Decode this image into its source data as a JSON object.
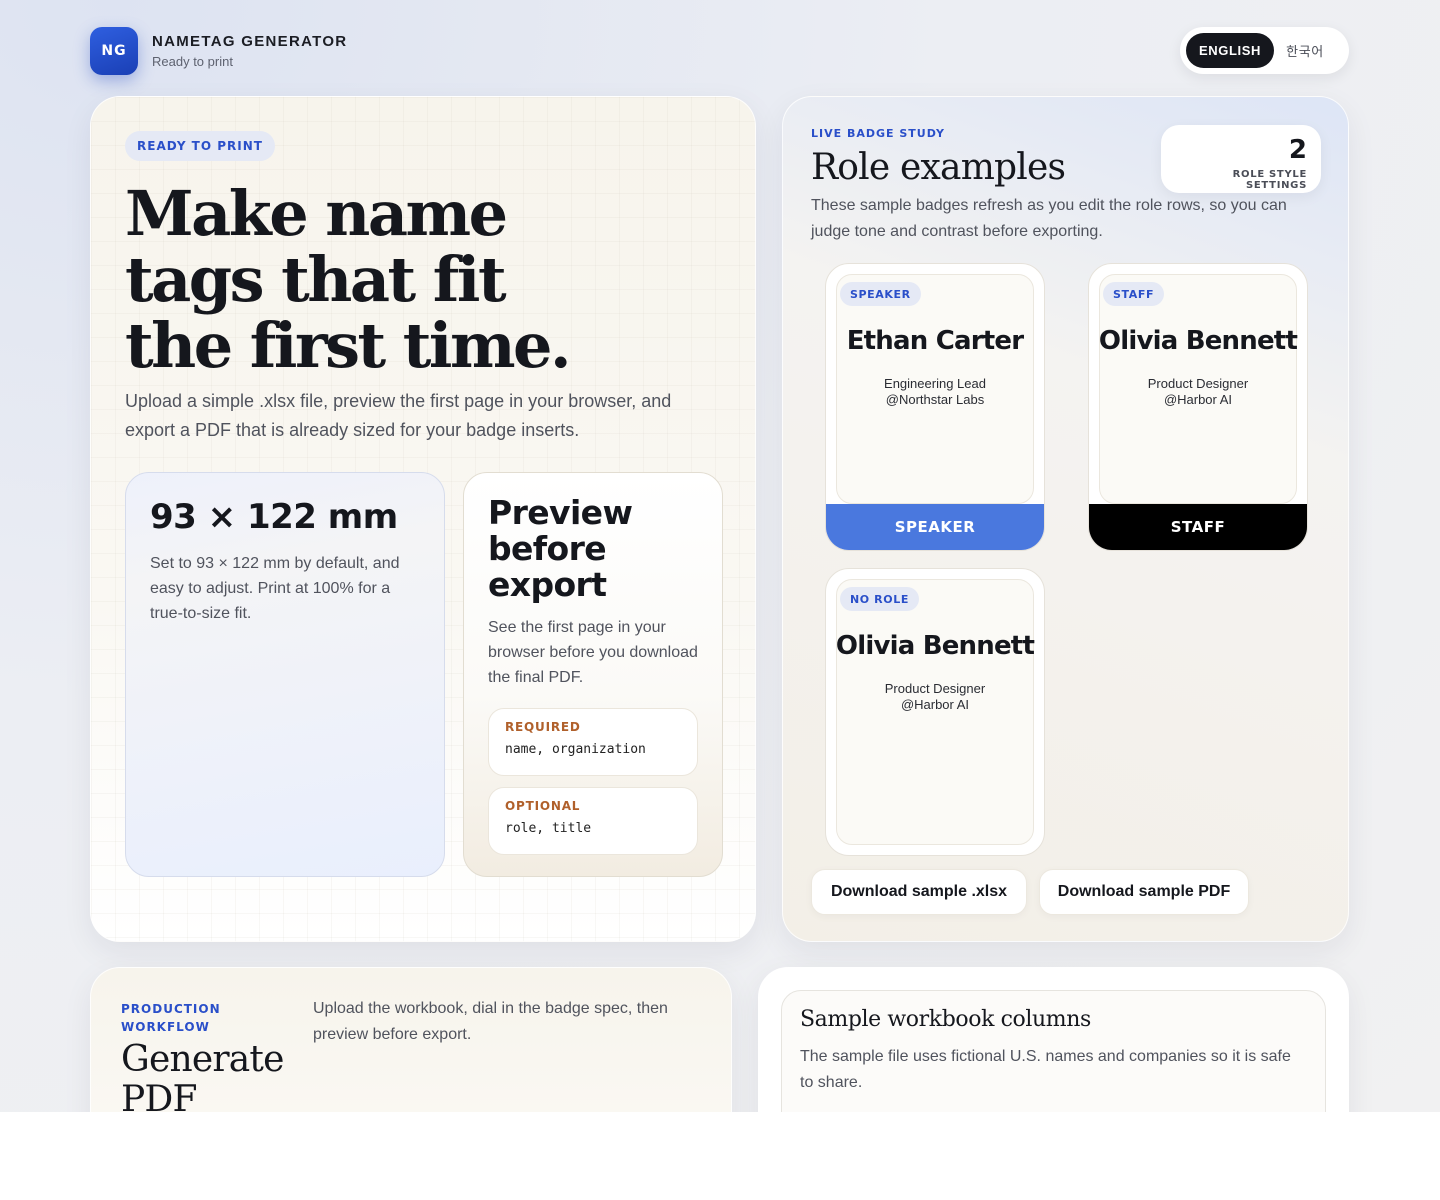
{
  "brand": {
    "logo": "NG",
    "title": "NAMETAG GENERATOR",
    "status": "Ready to print"
  },
  "language": {
    "active": "ENGLISH",
    "inactive": "한국어"
  },
  "hero": {
    "pill": "READY TO PRINT",
    "title_lines": [
      "Make name",
      "tags that fit",
      "the first time."
    ],
    "body": "Upload a simple .xlsx file, preview the first page in your browser, and export a PDF that is already sized for your badge inserts.",
    "size_card": {
      "title": "93 × 122 mm",
      "body": "Set to 93 × 122 mm by default, and easy to adjust. Print at 100% for a true-to-size fit."
    },
    "preview_card": {
      "title": "Preview before export",
      "body": "See the first page in your browser before you download the final PDF.",
      "required_label": "REQUIRED",
      "required_value": "name, organization",
      "optional_label": "OPTIONAL",
      "optional_value": "role, title"
    }
  },
  "examples": {
    "eyebrow": "LIVE BADGE STUDY",
    "title": "Role examples",
    "body": "These sample badges refresh as you edit the role rows, so you can judge tone and contrast before exporting.",
    "count": "2",
    "count_label": "ROLE STYLE SETTINGS",
    "badges": [
      {
        "pill": "SPEAKER",
        "name": "Ethan Carter",
        "title": "Engineering Lead",
        "org": "@Northstar Labs",
        "bar": "SPEAKER",
        "bar_color": "#4a78de"
      },
      {
        "pill": "STAFF",
        "name": "Olivia Bennett",
        "title": "Product Designer",
        "org": "@Harbor AI",
        "bar": "STAFF",
        "bar_color": "#000000"
      },
      {
        "pill": "NO ROLE",
        "name": "Olivia Bennett",
        "title": "Product Designer",
        "org": "@Harbor AI"
      }
    ],
    "download_xlsx": "Download sample .xlsx",
    "download_pdf": "Download sample PDF"
  },
  "workflow": {
    "eyebrow": "PRODUCTION WORKFLOW",
    "title": "Generate PDF",
    "body": "Upload the workbook, dial in the badge spec, then preview before export."
  },
  "columns": {
    "title": "Sample workbook columns",
    "body": "The sample file uses fictional U.S. names and companies so it is safe to share."
  }
}
